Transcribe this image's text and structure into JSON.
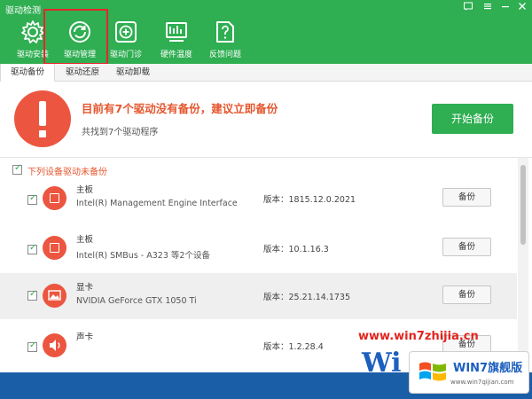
{
  "window": {
    "title": "驱动检测"
  },
  "toolbar": {
    "items": [
      {
        "label": "驱动安装",
        "icon": "gear-icon"
      },
      {
        "label": "驱动管理",
        "icon": "refresh-icon"
      },
      {
        "label": "驱动门诊",
        "icon": "clinic-icon"
      },
      {
        "label": "硬件温度",
        "icon": "thermometer-icon"
      },
      {
        "label": "反馈问题",
        "icon": "question-icon"
      }
    ],
    "selected_index": 1
  },
  "tabs": [
    {
      "label": "驱动备份",
      "active": true
    },
    {
      "label": "驱动还原",
      "active": false
    },
    {
      "label": "驱动卸载",
      "active": false
    }
  ],
  "alert": {
    "title": "目前有7个驱动没有备份，建议立即备份",
    "subtitle": "共找到7个驱动程序",
    "button": "开始备份"
  },
  "section": {
    "title": "下列设备驱动未备份",
    "checked": true
  },
  "devices": [
    {
      "category": "主板",
      "name": "Intel(R) Management Engine Interface",
      "version": "版本：1815.12.0.2021",
      "button": "备份",
      "checked": true,
      "highlighted": false
    },
    {
      "category": "主板",
      "name": "Intel(R) SMBus - A323 等2个设备",
      "version": "版本：10.1.16.3",
      "button": "备份",
      "checked": true,
      "highlighted": false
    },
    {
      "category": "显卡",
      "name": "NVIDIA GeForce GTX 1050 Ti",
      "version": "版本：25.21.14.1735",
      "button": "备份",
      "checked": true,
      "highlighted": true
    },
    {
      "category": "声卡",
      "name": "",
      "version": "版本：1.2.28.4",
      "button": "备份",
      "checked": true,
      "highlighted": false
    }
  ],
  "watermark": {
    "url": "www.win7zhijia.cn",
    "logo_text": "Wi",
    "brand": "WIN7旗舰版",
    "small": "www.win7qijian.com"
  },
  "colors": {
    "brand_green": "#2fae52",
    "alert_red": "#ec5640",
    "selection_red": "#e5262a"
  }
}
